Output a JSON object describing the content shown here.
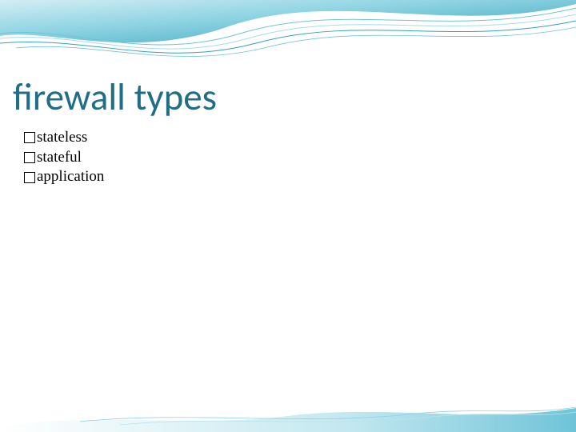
{
  "title": "firewall types",
  "bullets": {
    "items": [
      {
        "text": "stateless"
      },
      {
        "text": "stateful"
      },
      {
        "text": "application"
      }
    ]
  },
  "colors": {
    "title": "#1f6d87",
    "wave_light": "#a8dbe8",
    "wave_mid": "#6fc4d8",
    "wave_dark": "#35a0bc"
  }
}
